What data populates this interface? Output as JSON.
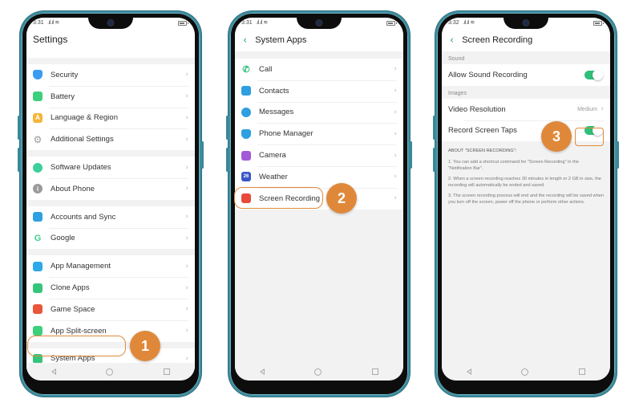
{
  "phone1": {
    "status_time": "3:31",
    "signal_glyph": "…… ≈",
    "title": "Settings",
    "groups": [
      [
        {
          "label": "Security",
          "icon": "shield-icon",
          "color": "#3a9bf0"
        },
        {
          "label": "Battery",
          "icon": "battery-icon",
          "color": "#3ccf7c"
        },
        {
          "label": "Language & Region",
          "icon": "language-icon",
          "color": "#f4b53a",
          "glyph": "A"
        },
        {
          "label": "Additional Settings",
          "icon": "gear-icon",
          "color": "#9a9a9a"
        }
      ],
      [
        {
          "label": "Software Updates",
          "icon": "update-icon",
          "color": "#3ccf9a"
        },
        {
          "label": "About Phone",
          "icon": "info-icon",
          "color": "#9a9a9a",
          "glyph": "i"
        }
      ],
      [
        {
          "label": "Accounts and Sync",
          "icon": "person-icon",
          "color": "#2e9fe0"
        },
        {
          "label": "Google",
          "icon": "google-icon",
          "color": "#3ccf8a",
          "glyph": "G"
        }
      ],
      [
        {
          "label": "App Management",
          "icon": "grid-icon",
          "color": "#2ea8e8"
        },
        {
          "label": "Clone Apps",
          "icon": "clone-icon",
          "color": "#35c57a"
        },
        {
          "label": "Game Space",
          "icon": "game-space-icon",
          "color": "#e8573a"
        },
        {
          "label": "App Split-screen",
          "icon": "split-screen-icon",
          "color": "#3ccf7c"
        }
      ],
      [
        {
          "label": "System Apps",
          "icon": "system-apps-icon",
          "color": "#35c57a"
        }
      ]
    ],
    "step_badge": "1"
  },
  "phone2": {
    "status_time": "3:31",
    "title": "System Apps",
    "items": [
      {
        "label": "Call",
        "icon": "phone-icon",
        "color": "#2fbf79"
      },
      {
        "label": "Contacts",
        "icon": "contacts-icon",
        "color": "#2e9fe0"
      },
      {
        "label": "Messages",
        "icon": "message-icon",
        "color": "#2e9fe0"
      },
      {
        "label": "Phone Manager",
        "icon": "shield-icon",
        "color": "#2e9fe0"
      },
      {
        "label": "Camera",
        "icon": "camera-icon",
        "color": "#a25ad8"
      },
      {
        "label": "Weather",
        "icon": "weather-icon",
        "color": "#3a56c8",
        "glyph": "26"
      },
      {
        "label": "Screen Recording",
        "icon": "screen-recording-icon",
        "color": "#e84a3a"
      }
    ],
    "step_badge": "2"
  },
  "phone3": {
    "status_time": "3:32",
    "title": "Screen Recording",
    "sections": [
      {
        "label": "Sound",
        "rows": [
          {
            "label": "Allow Sound Recording",
            "type": "toggle",
            "on": true
          }
        ]
      },
      {
        "label": "Images",
        "rows": [
          {
            "label": "Video Resolution",
            "type": "value",
            "value": "Medium"
          },
          {
            "label": "Record Screen Taps",
            "type": "toggle",
            "on": true
          }
        ]
      }
    ],
    "about_title": "ABOUT \"SCREEN RECORDING\":",
    "about_items": [
      "1. You can add a shortcut command for \"Screen Recording\" in the \"Notification Bar\".",
      "2. When a screen recording reaches 30 minutes in length or 2 GB in size, the recording will automatically be ended and saved.",
      "3. The screen recording process will end and the recording will be saved when you turn off the screen, power off the phone or perform other actions."
    ],
    "step_badge": "3"
  },
  "colors": {
    "accent": "#2fbf79",
    "annotation": "#e0883a",
    "frame": "#3f8fa0"
  }
}
